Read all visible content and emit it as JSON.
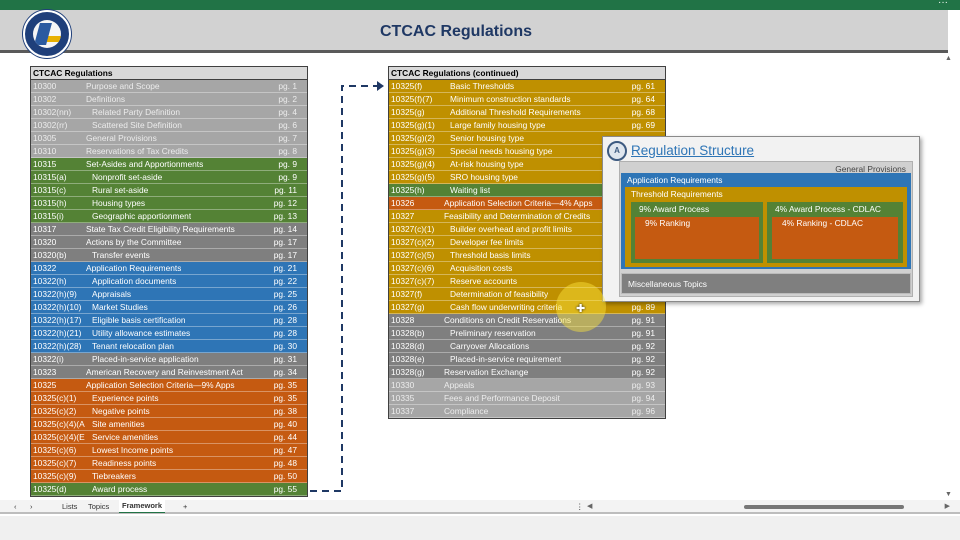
{
  "header": {
    "title": "CTCAC Regulations",
    "logo_text": "California Tax Credit Allocation Committee TCAC"
  },
  "left_table": {
    "title": "CTCAC Regulations",
    "rows": [
      {
        "code": "10300",
        "desc": "Purpose and Scope",
        "page": "pg. 1",
        "color": "lgray",
        "level": 0
      },
      {
        "code": "10302",
        "desc": "Definitions",
        "page": "pg. 2",
        "color": "lgray",
        "level": 0
      },
      {
        "code": "10302(nn)",
        "desc": "Related Party Definition",
        "page": "pg. 4",
        "color": "lgray",
        "level": 1
      },
      {
        "code": "10302(rr)",
        "desc": "Scattered Site Definition",
        "page": "pg. 6",
        "color": "lgray",
        "level": 1
      },
      {
        "code": "10305",
        "desc": "General Provisions",
        "page": "pg. 7",
        "color": "lgray",
        "level": 0
      },
      {
        "code": "10310",
        "desc": "Reservations of Tax Credits",
        "page": "pg. 8",
        "color": "lgray",
        "level": 0
      },
      {
        "code": "10315",
        "desc": "Set-Asides and Apportionments",
        "page": "pg. 9",
        "color": "green",
        "level": 0
      },
      {
        "code": "10315(a)",
        "desc": "Nonprofit set-aside",
        "page": "pg. 9",
        "color": "green",
        "level": 1
      },
      {
        "code": "10315(c)",
        "desc": "Rural set-aside",
        "page": "pg. 11",
        "color": "green",
        "level": 1
      },
      {
        "code": "10315(h)",
        "desc": "Housing types",
        "page": "pg. 12",
        "color": "green",
        "level": 1
      },
      {
        "code": "10315(i)",
        "desc": "Geographic apportionment",
        "page": "pg. 13",
        "color": "green",
        "level": 1
      },
      {
        "code": "10317",
        "desc": "State Tax Credit Eligibility Requirements",
        "page": "pg. 14",
        "color": "dgray",
        "level": 0
      },
      {
        "code": "10320",
        "desc": "Actions by the Committee",
        "page": "pg. 17",
        "color": "dgray",
        "level": 0
      },
      {
        "code": "10320(b)",
        "desc": "Transfer events",
        "page": "pg. 17",
        "color": "dgray",
        "level": 1
      },
      {
        "code": "10322",
        "desc": "Application Requirements",
        "page": "pg. 21",
        "color": "blue",
        "level": 0
      },
      {
        "code": "10322(h)",
        "desc": "Application documents",
        "page": "pg. 22",
        "color": "blue",
        "level": 1
      },
      {
        "code": "10322(h)(9)",
        "desc": "Appraisals",
        "page": "pg. 25",
        "color": "blue",
        "level": 1
      },
      {
        "code": "10322(h)(10)",
        "desc": "Market Studies",
        "page": "pg. 26",
        "color": "blue",
        "level": 1
      },
      {
        "code": "10322(h)(17)",
        "desc": "Eligible basis certification",
        "page": "pg. 28",
        "color": "blue",
        "level": 1
      },
      {
        "code": "10322(h)(21)",
        "desc": "Utility allowance estimates",
        "page": "pg. 28",
        "color": "blue",
        "level": 1
      },
      {
        "code": "10322(h)(28)",
        "desc": "Tenant relocation plan",
        "page": "pg. 30",
        "color": "blue",
        "level": 1
      },
      {
        "code": "10322(i)",
        "desc": "Placed-in-service application",
        "page": "pg. 31",
        "color": "dgray",
        "level": 1
      },
      {
        "code": "10323",
        "desc": "American Recovery and Reinvestment Act",
        "page": "pg. 34",
        "color": "dgray",
        "level": 0
      },
      {
        "code": "10325",
        "desc": "Application Selection Criteria—9% Apps",
        "page": "pg. 35",
        "color": "orange",
        "level": 0
      },
      {
        "code": "10325(c)(1)",
        "desc": "Experience points",
        "page": "pg. 35",
        "color": "orange",
        "level": 1
      },
      {
        "code": "10325(c)(2)",
        "desc": "Negative points",
        "page": "pg. 38",
        "color": "orange",
        "level": 1
      },
      {
        "code": "10325(c)(4)(A",
        "desc": "Site amenities",
        "page": "pg. 40",
        "color": "orange",
        "level": 1
      },
      {
        "code": "10325(c)(4)(E",
        "desc": "Service amenities",
        "page": "pg. 44",
        "color": "orange",
        "level": 1
      },
      {
        "code": "10325(c)(6)",
        "desc": "Lowest Income points",
        "page": "pg. 47",
        "color": "orange",
        "level": 1
      },
      {
        "code": "10325(c)(7)",
        "desc": "Readiness points",
        "page": "pg. 48",
        "color": "orange",
        "level": 1
      },
      {
        "code": "10325(c)(9)",
        "desc": "Tiebreakers",
        "page": "pg. 50",
        "color": "orange",
        "level": 1
      },
      {
        "code": "10325(d)",
        "desc": "Award process",
        "page": "pg. 55",
        "color": "green",
        "level": 1
      }
    ]
  },
  "right_table": {
    "title": "CTCAC Regulations (continued)",
    "rows": [
      {
        "code": "10325(f)",
        "desc": "Basic Thresholds",
        "page": "pg. 61",
        "color": "gold",
        "level": 1
      },
      {
        "code": "10325(f)(7)",
        "desc": "Minimum construction standards",
        "page": "pg. 64",
        "color": "gold",
        "level": 1
      },
      {
        "code": "10325(g)",
        "desc": "Additional Threshold Requirements",
        "page": "pg. 68",
        "color": "gold",
        "level": 1
      },
      {
        "code": "10325(g)(1)",
        "desc": "Large family housing type",
        "page": "pg. 69",
        "color": "gold",
        "level": 1
      },
      {
        "code": "10325(g)(2)",
        "desc": "Senior housing type",
        "page": "",
        "color": "gold",
        "level": 1
      },
      {
        "code": "10325(g)(3)",
        "desc": "Special needs housing type",
        "page": "",
        "color": "gold",
        "level": 1
      },
      {
        "code": "10325(g)(4)",
        "desc": "At-risk housing type",
        "page": "",
        "color": "gold",
        "level": 1
      },
      {
        "code": "10325(g)(5)",
        "desc": "SRO housing type",
        "page": "",
        "color": "gold",
        "level": 1
      },
      {
        "code": "10325(h)",
        "desc": "Waiting list",
        "page": "",
        "color": "green",
        "level": 1
      },
      {
        "code": "10326",
        "desc": "Application Selection Criteria—4% Apps",
        "page": "",
        "color": "orange",
        "level": 0
      },
      {
        "code": "10327",
        "desc": "Feasibility and Determination of Credits",
        "page": "",
        "color": "gold",
        "level": 0
      },
      {
        "code": "10327(c)(1)",
        "desc": "Builder overhead and profit limits",
        "page": "",
        "color": "gold",
        "level": 1
      },
      {
        "code": "10327(c)(2)",
        "desc": "Developer fee limits",
        "page": "",
        "color": "gold",
        "level": 1
      },
      {
        "code": "10327(c)(5)",
        "desc": "Threshold basis limits",
        "page": "",
        "color": "gold",
        "level": 1
      },
      {
        "code": "10327(c)(6)",
        "desc": "Acquisition costs",
        "page": "",
        "color": "gold",
        "level": 1
      },
      {
        "code": "10327(c)(7)",
        "desc": "Reserve accounts",
        "page": "",
        "color": "gold",
        "level": 1
      },
      {
        "code": "10327(f)",
        "desc": "Determination of feasibility",
        "page": "",
        "color": "gold",
        "level": 1
      },
      {
        "code": "10327(g)",
        "desc": "Cash flow underwriting criteria",
        "page": "pg. 89",
        "color": "gold",
        "level": 1
      },
      {
        "code": "10328",
        "desc": "Conditions on Credit Reservations",
        "page": "pg. 91",
        "color": "dgray",
        "level": 0
      },
      {
        "code": "10328(b)",
        "desc": "Preliminary reservation",
        "page": "pg. 91",
        "color": "dgray",
        "level": 1
      },
      {
        "code": "10328(d)",
        "desc": "Carryover Allocations",
        "page": "pg. 92",
        "color": "dgray",
        "level": 1
      },
      {
        "code": "10328(e)",
        "desc": "Placed-in-service requirement",
        "page": "pg. 92",
        "color": "dgray",
        "level": 1
      },
      {
        "code": "10328(g)",
        "desc": "Reservation Exchange",
        "page": "pg. 92",
        "color": "dgray",
        "level": 0
      },
      {
        "code": "10330",
        "desc": "Appeals",
        "page": "pg. 93",
        "color": "lgray",
        "level": 0
      },
      {
        "code": "10335",
        "desc": "Fees and Performance Deposit",
        "page": "pg. 94",
        "color": "lgray",
        "level": 0
      },
      {
        "code": "10337",
        "desc": "Compliance",
        "page": "pg. 96",
        "color": "lgray",
        "level": 0
      }
    ]
  },
  "popup": {
    "title": "Regulation Structure",
    "general": "General Provisions",
    "application": "Application Requirements",
    "threshold": "Threshold Requirements",
    "award9": "9% Award Process",
    "rank9": "9% Ranking",
    "award4": "4% Award Process - CDLAC",
    "rank4": "4% Ranking - CDLAC",
    "misc": "Miscellaneous Topics"
  },
  "sheet_tabs": [
    {
      "label": "Lists"
    },
    {
      "label": "Topics"
    },
    {
      "label": "Framework",
      "active": true
    }
  ],
  "sheet_add": "+"
}
